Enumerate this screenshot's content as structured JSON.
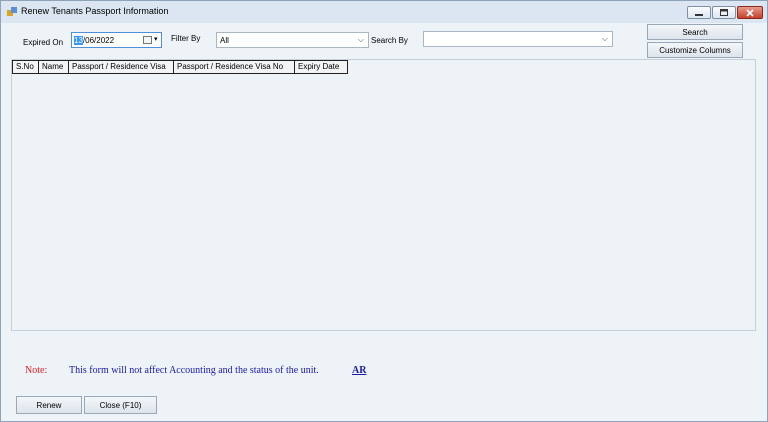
{
  "window": {
    "title": "Renew Tenants Passport Information",
    "controls": {
      "minimize": "minimize-icon",
      "maximize": "maximize-icon",
      "close": "close-icon"
    }
  },
  "filters": {
    "expired_on_label": "Expired On",
    "expired_on_day": "13",
    "expired_on_rest": "/06/2022",
    "filter_by_label": "Filter By",
    "filter_by_value": "All",
    "search_by_label": "Search By",
    "search_by_value": ""
  },
  "toolbar": {
    "search_label": "Search",
    "customize_label": "Customize Columns"
  },
  "grid": {
    "columns": [
      "S.No",
      "Name",
      "Passport / Residence Visa",
      "Passport / Residence Visa No",
      "Expiry Date"
    ],
    "rows": []
  },
  "note": {
    "label": "Note:",
    "text": "This form will not affect Accounting and the status of the unit.",
    "link": "AR"
  },
  "footer": {
    "renew_label": "Renew",
    "close_label": "Close (F10)"
  },
  "colors": {
    "background": "#eef3f8",
    "note_label": "#e02020",
    "note_text": "#1a1aa8"
  }
}
